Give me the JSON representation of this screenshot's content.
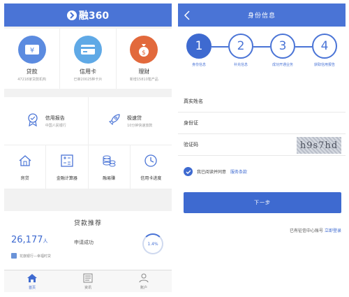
{
  "left": {
    "brand": "融360",
    "features": [
      {
        "title": "贷款",
        "sub": "47218家贷款机构",
        "color": "#5b8be0",
        "icon": "yen-card-icon"
      },
      {
        "title": "信用卡",
        "sub": "已审20025种卡片",
        "color": "#5fa9e6",
        "icon": "credit-card-icon"
      },
      {
        "title": "理财",
        "sub": "新增15810笔产品",
        "color": "#e2693c",
        "icon": "money-bag-icon"
      }
    ],
    "row2": [
      {
        "title": "信用报告",
        "sub": "中国人民银行",
        "icon": "medal-icon"
      },
      {
        "title": "极速贷",
        "sub": "10分钟快速放款",
        "icon": "rocket-icon"
      }
    ],
    "row4": [
      {
        "title": "房贷",
        "icon": "house-icon"
      },
      {
        "title": "金融计算器",
        "icon": "calculator-icon"
      },
      {
        "title": "融易赚",
        "icon": "coins-icon"
      },
      {
        "title": "信用卡进度",
        "icon": "clock-icon"
      }
    ],
    "loan": {
      "title": "贷款推荐",
      "count": "26,177",
      "count_unit": "人",
      "status": "申请成功",
      "bank": "花旗银行—幸福时贷",
      "rate": "1.4%"
    },
    "tabs": [
      {
        "label": "首页",
        "icon": "home-icon"
      },
      {
        "label": "资讯",
        "icon": "news-icon"
      },
      {
        "label": "账户",
        "icon": "user-icon"
      }
    ]
  },
  "right": {
    "title": "身份信息",
    "steps": [
      {
        "num": "1",
        "label": "身份信息"
      },
      {
        "num": "2",
        "label": "补充信息"
      },
      {
        "num": "3",
        "label": "成功开通业务"
      },
      {
        "num": "4",
        "label": "获取信用报告"
      }
    ],
    "fields": {
      "name": "真实姓名",
      "id": "身份证",
      "code": "验证码",
      "captcha": "h9s7hd"
    },
    "agree_text": "我已阅读并同意",
    "terms": "服务条款",
    "next": "下一步",
    "login_hint": "已有征信中心账号",
    "login_link": "立即登录"
  }
}
